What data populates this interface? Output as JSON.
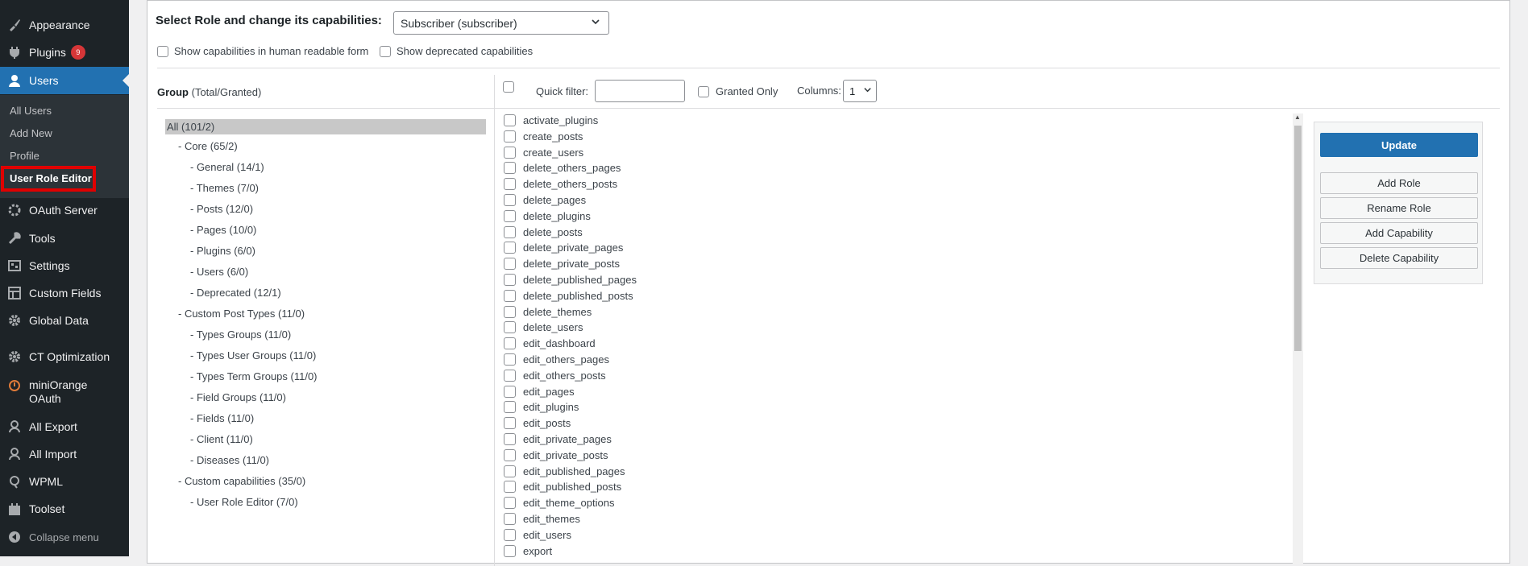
{
  "sidebar": {
    "items": [
      {
        "label": "Appearance",
        "icon": "paintbrush-icon"
      },
      {
        "label": "Plugins",
        "icon": "plugin-icon",
        "badge": "9"
      },
      {
        "label": "Users",
        "icon": "users-icon"
      },
      {
        "label": "OAuth Server",
        "icon": "oauth-server-icon"
      },
      {
        "label": "Tools",
        "icon": "tools-icon"
      },
      {
        "label": "Settings",
        "icon": "settings-icon"
      },
      {
        "label": "Custom Fields",
        "icon": "custom-fields-icon"
      },
      {
        "label": "Global Data",
        "icon": "gear-icon"
      },
      {
        "label": "CT Optimization",
        "icon": "gear-icon"
      },
      {
        "label": "miniOrange\nOAuth",
        "icon": "miniorange-icon"
      },
      {
        "label": "All Export",
        "icon": "export-icon"
      },
      {
        "label": "All Import",
        "icon": "import-icon"
      },
      {
        "label": "WPML",
        "icon": "wpml-icon"
      },
      {
        "label": "Toolset",
        "icon": "toolset-icon"
      },
      {
        "label": "Collapse menu",
        "icon": "collapse-icon"
      }
    ],
    "submenu": [
      "All Users",
      "Add New",
      "Profile",
      "User Role Editor"
    ]
  },
  "header": {
    "select_label": "Select Role and change its capabilities:",
    "role_selected": "Subscriber (subscriber)",
    "opt_human": "Show capabilities in human readable form",
    "opt_deprecated": "Show deprecated capabilities"
  },
  "groups": {
    "title": "Group",
    "subtitle": " (Total/Granted)",
    "items": [
      "All (101/2)",
      "- Core (65/2)",
      "- General (14/1)",
      "- Themes (7/0)",
      "- Posts (12/0)",
      "- Pages (10/0)",
      "- Plugins (6/0)",
      "- Users (6/0)",
      "- Deprecated (12/1)",
      "- Custom Post Types (11/0)",
      "- Types Groups (11/0)",
      "- Types User Groups (11/0)",
      "- Types Term Groups (11/0)",
      "- Field Groups (11/0)",
      "- Fields (11/0)",
      "- Client (11/0)",
      "- Diseases (11/0)",
      "- Custom capabilities (35/0)",
      "- User Role Editor (7/0)"
    ]
  },
  "filters": {
    "quick_filter": "Quick filter:",
    "granted_only": "Granted Only",
    "columns_label": "Columns:",
    "columns_value": "1"
  },
  "capabilities": [
    "activate_plugins",
    "create_posts",
    "create_users",
    "delete_others_pages",
    "delete_others_posts",
    "delete_pages",
    "delete_plugins",
    "delete_posts",
    "delete_private_pages",
    "delete_private_posts",
    "delete_published_pages",
    "delete_published_posts",
    "delete_themes",
    "delete_users",
    "edit_dashboard",
    "edit_others_pages",
    "edit_others_posts",
    "edit_pages",
    "edit_plugins",
    "edit_posts",
    "edit_private_pages",
    "edit_private_posts",
    "edit_published_pages",
    "edit_published_posts",
    "edit_theme_options",
    "edit_themes",
    "edit_users",
    "export"
  ],
  "actions": {
    "update": "Update",
    "add_role": "Add Role",
    "rename_role": "Rename Role",
    "add_capability": "Add Capability",
    "delete_capability": "Delete Capability"
  },
  "colors": {
    "sidebar_bg": "#1d2327",
    "accent": "#2271b1",
    "highlight_box": "#e00000",
    "badge": "#d63638"
  }
}
